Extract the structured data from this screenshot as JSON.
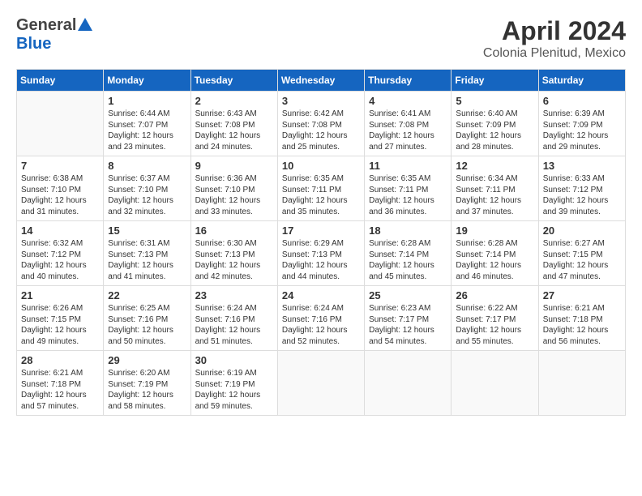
{
  "header": {
    "logo_general": "General",
    "logo_blue": "Blue",
    "title": "April 2024",
    "location": "Colonia Plenitud, Mexico"
  },
  "weekdays": [
    "Sunday",
    "Monday",
    "Tuesday",
    "Wednesday",
    "Thursday",
    "Friday",
    "Saturday"
  ],
  "weeks": [
    [
      {
        "num": "",
        "info": ""
      },
      {
        "num": "1",
        "info": "Sunrise: 6:44 AM\nSunset: 7:07 PM\nDaylight: 12 hours\nand 23 minutes."
      },
      {
        "num": "2",
        "info": "Sunrise: 6:43 AM\nSunset: 7:08 PM\nDaylight: 12 hours\nand 24 minutes."
      },
      {
        "num": "3",
        "info": "Sunrise: 6:42 AM\nSunset: 7:08 PM\nDaylight: 12 hours\nand 25 minutes."
      },
      {
        "num": "4",
        "info": "Sunrise: 6:41 AM\nSunset: 7:08 PM\nDaylight: 12 hours\nand 27 minutes."
      },
      {
        "num": "5",
        "info": "Sunrise: 6:40 AM\nSunset: 7:09 PM\nDaylight: 12 hours\nand 28 minutes."
      },
      {
        "num": "6",
        "info": "Sunrise: 6:39 AM\nSunset: 7:09 PM\nDaylight: 12 hours\nand 29 minutes."
      }
    ],
    [
      {
        "num": "7",
        "info": "Sunrise: 6:38 AM\nSunset: 7:10 PM\nDaylight: 12 hours\nand 31 minutes."
      },
      {
        "num": "8",
        "info": "Sunrise: 6:37 AM\nSunset: 7:10 PM\nDaylight: 12 hours\nand 32 minutes."
      },
      {
        "num": "9",
        "info": "Sunrise: 6:36 AM\nSunset: 7:10 PM\nDaylight: 12 hours\nand 33 minutes."
      },
      {
        "num": "10",
        "info": "Sunrise: 6:35 AM\nSunset: 7:11 PM\nDaylight: 12 hours\nand 35 minutes."
      },
      {
        "num": "11",
        "info": "Sunrise: 6:35 AM\nSunset: 7:11 PM\nDaylight: 12 hours\nand 36 minutes."
      },
      {
        "num": "12",
        "info": "Sunrise: 6:34 AM\nSunset: 7:11 PM\nDaylight: 12 hours\nand 37 minutes."
      },
      {
        "num": "13",
        "info": "Sunrise: 6:33 AM\nSunset: 7:12 PM\nDaylight: 12 hours\nand 39 minutes."
      }
    ],
    [
      {
        "num": "14",
        "info": "Sunrise: 6:32 AM\nSunset: 7:12 PM\nDaylight: 12 hours\nand 40 minutes."
      },
      {
        "num": "15",
        "info": "Sunrise: 6:31 AM\nSunset: 7:13 PM\nDaylight: 12 hours\nand 41 minutes."
      },
      {
        "num": "16",
        "info": "Sunrise: 6:30 AM\nSunset: 7:13 PM\nDaylight: 12 hours\nand 42 minutes."
      },
      {
        "num": "17",
        "info": "Sunrise: 6:29 AM\nSunset: 7:13 PM\nDaylight: 12 hours\nand 44 minutes."
      },
      {
        "num": "18",
        "info": "Sunrise: 6:28 AM\nSunset: 7:14 PM\nDaylight: 12 hours\nand 45 minutes."
      },
      {
        "num": "19",
        "info": "Sunrise: 6:28 AM\nSunset: 7:14 PM\nDaylight: 12 hours\nand 46 minutes."
      },
      {
        "num": "20",
        "info": "Sunrise: 6:27 AM\nSunset: 7:15 PM\nDaylight: 12 hours\nand 47 minutes."
      }
    ],
    [
      {
        "num": "21",
        "info": "Sunrise: 6:26 AM\nSunset: 7:15 PM\nDaylight: 12 hours\nand 49 minutes."
      },
      {
        "num": "22",
        "info": "Sunrise: 6:25 AM\nSunset: 7:16 PM\nDaylight: 12 hours\nand 50 minutes."
      },
      {
        "num": "23",
        "info": "Sunrise: 6:24 AM\nSunset: 7:16 PM\nDaylight: 12 hours\nand 51 minutes."
      },
      {
        "num": "24",
        "info": "Sunrise: 6:24 AM\nSunset: 7:16 PM\nDaylight: 12 hours\nand 52 minutes."
      },
      {
        "num": "25",
        "info": "Sunrise: 6:23 AM\nSunset: 7:17 PM\nDaylight: 12 hours\nand 54 minutes."
      },
      {
        "num": "26",
        "info": "Sunrise: 6:22 AM\nSunset: 7:17 PM\nDaylight: 12 hours\nand 55 minutes."
      },
      {
        "num": "27",
        "info": "Sunrise: 6:21 AM\nSunset: 7:18 PM\nDaylight: 12 hours\nand 56 minutes."
      }
    ],
    [
      {
        "num": "28",
        "info": "Sunrise: 6:21 AM\nSunset: 7:18 PM\nDaylight: 12 hours\nand 57 minutes."
      },
      {
        "num": "29",
        "info": "Sunrise: 6:20 AM\nSunset: 7:19 PM\nDaylight: 12 hours\nand 58 minutes."
      },
      {
        "num": "30",
        "info": "Sunrise: 6:19 AM\nSunset: 7:19 PM\nDaylight: 12 hours\nand 59 minutes."
      },
      {
        "num": "",
        "info": ""
      },
      {
        "num": "",
        "info": ""
      },
      {
        "num": "",
        "info": ""
      },
      {
        "num": "",
        "info": ""
      }
    ]
  ]
}
